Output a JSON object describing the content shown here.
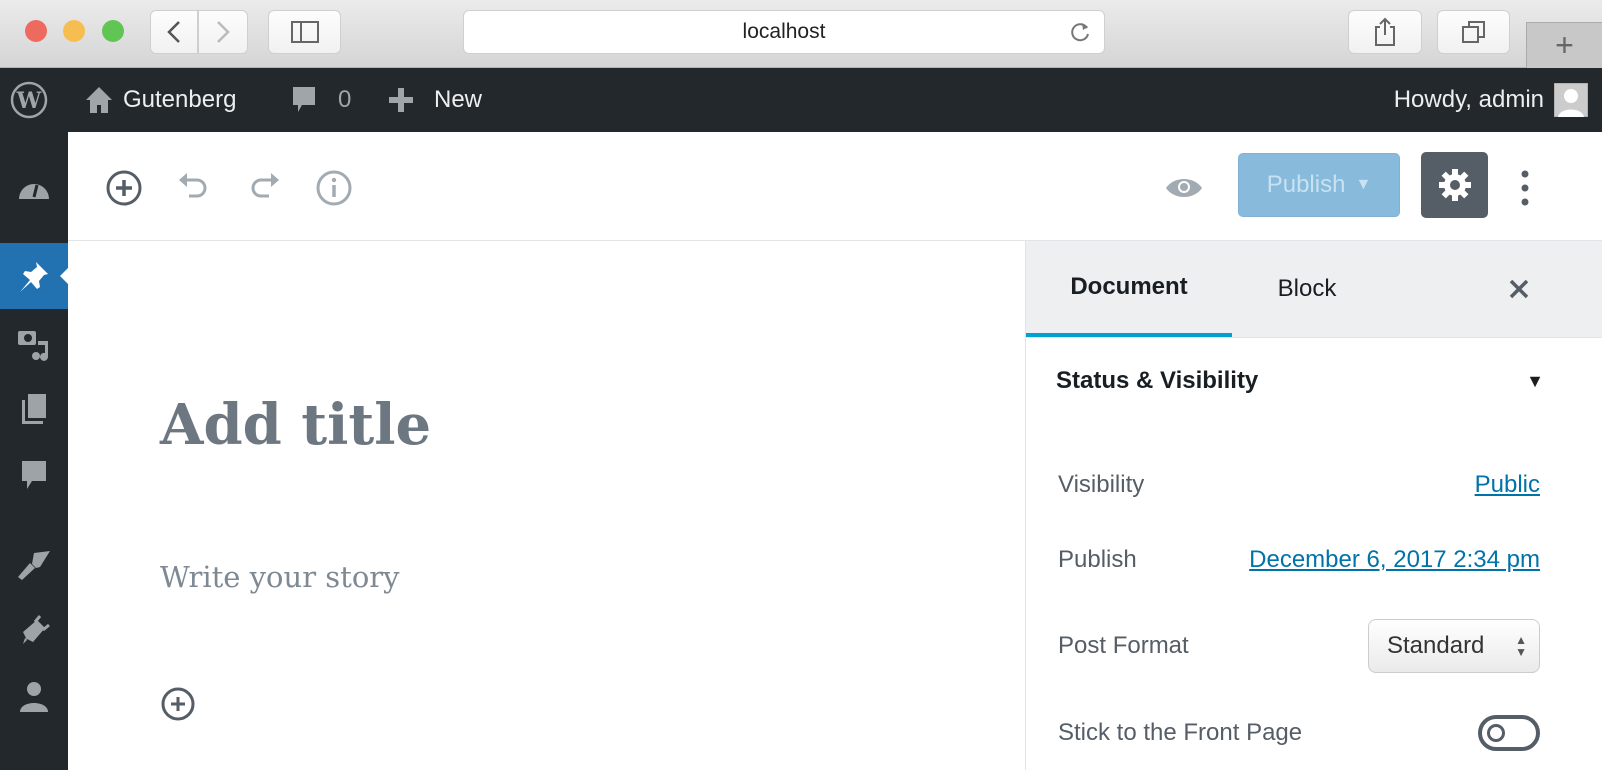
{
  "browser": {
    "url": "localhost"
  },
  "adminbar": {
    "site": "Gutenberg",
    "comments": "0",
    "new": "New",
    "howdy": "Howdy, admin"
  },
  "toolbar": {
    "publish": "Publish"
  },
  "editor": {
    "title_placeholder": "Add title",
    "body_placeholder": "Write your story"
  },
  "panel": {
    "tabs": [
      "Document",
      "Block"
    ],
    "section": "Status & Visibility",
    "visibility_label": "Visibility",
    "visibility_value": "Public",
    "publish_label": "Publish",
    "publish_value": "December 6, 2017 2:34 pm",
    "format_label": "Post Format",
    "format_value": "Standard",
    "sticky_label": "Stick to the Front Page"
  },
  "colors": {
    "accent": "#0073aa",
    "adminbar": "#23282d",
    "active_menu": "#2271b1"
  }
}
